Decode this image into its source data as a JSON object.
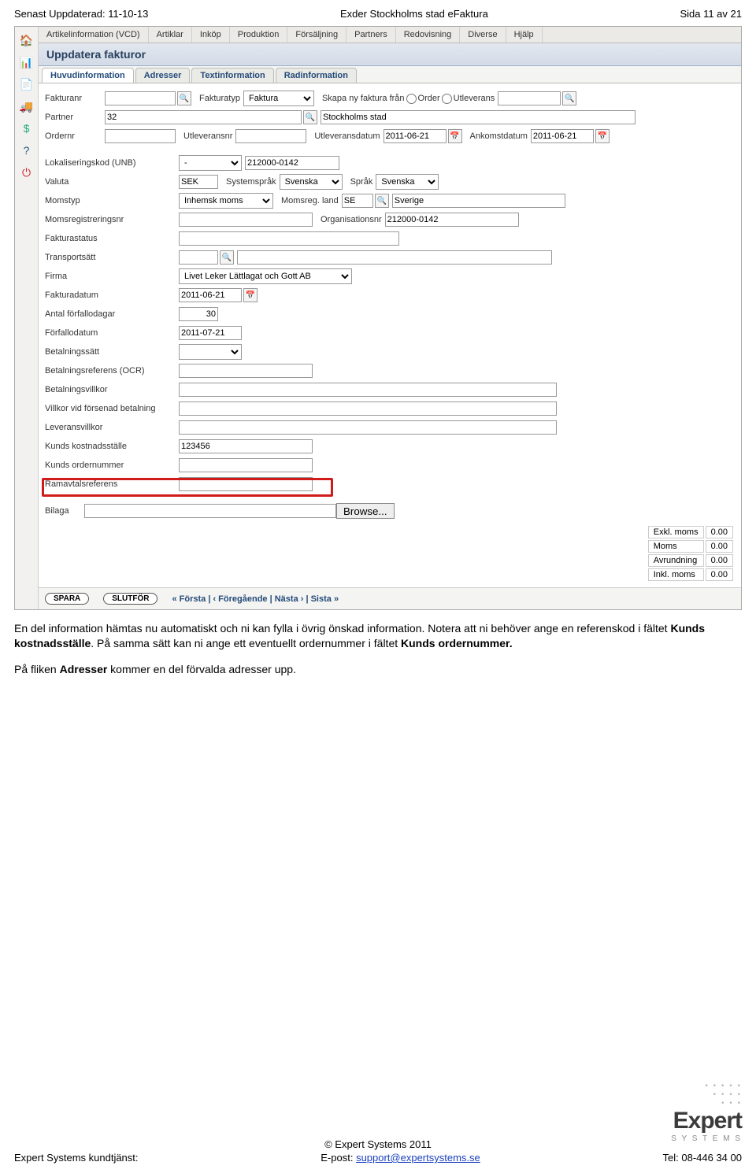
{
  "doc_header": {
    "updated": "Senast Uppdaterad: 11-10-13",
    "title": "Exder Stockholms stad eFaktura",
    "page": "Sida 11 av 21"
  },
  "sidebar_icons": [
    "home-icon",
    "chart-icon",
    "doc-icon",
    "truck-icon",
    "dollar-icon",
    "help-icon",
    "power-icon"
  ],
  "topmenu": [
    "Artikelinformation (VCD)",
    "Artiklar",
    "Inköp",
    "Produktion",
    "Försäljning",
    "Partners",
    "Redovisning",
    "Diverse",
    "Hjälp"
  ],
  "page_title": "Uppdatera fakturor",
  "subtabs": [
    "Huvudinformation",
    "Adresser",
    "Textinformation",
    "Radinformation"
  ],
  "row1": {
    "fakturanr_lbl": "Fakturanr",
    "fakturatyp_lbl": "Fakturatyp",
    "fakturatyp_val": "Faktura",
    "skapa_lbl": "Skapa ny faktura från",
    "opt_order": "Order",
    "opt_utleverans": "Utleverans"
  },
  "row2": {
    "partner_lbl": "Partner",
    "partner_val": "32",
    "partner_name": "Stockholms stad"
  },
  "row3": {
    "ordernr_lbl": "Ordernr",
    "utleveransnr_lbl": "Utleveransnr",
    "utleveransdatum_lbl": "Utleveransdatum",
    "utleveransdatum_val": "2011-06-21",
    "ankomstdatum_lbl": "Ankomstdatum",
    "ankomstdatum_val": "2011-06-21"
  },
  "row4": {
    "lbl": "Lokaliseringskod (UNB)",
    "sel": "-",
    "val": "212000-0142"
  },
  "row5": {
    "lbl": "Valuta",
    "val": "SEK",
    "sysspr_lbl": "Systemspråk",
    "sysspr_val": "Svenska",
    "sprak_lbl": "Språk",
    "sprak_val": "Svenska"
  },
  "row6": {
    "lbl": "Momstyp",
    "val": "Inhemsk moms",
    "momsregland_lbl": "Momsreg. land",
    "momsregland_val": "SE",
    "country": "Sverige"
  },
  "row7": {
    "lbl": "Momsregistreringsnr",
    "orgnr_lbl": "Organisationsnr",
    "orgnr_val": "212000-0142"
  },
  "row8": {
    "lbl": "Fakturastatus"
  },
  "row9": {
    "lbl": "Transportsätt"
  },
  "row10": {
    "lbl": "Firma",
    "val": "Livet Leker Lättlagat och Gott AB"
  },
  "row11": {
    "lbl": "Fakturadatum",
    "val": "2011-06-21"
  },
  "row12": {
    "lbl": "Antal förfallodagar",
    "val": "30"
  },
  "row13": {
    "lbl": "Förfallodatum",
    "val": "2011-07-21"
  },
  "row14": {
    "lbl": "Betalningssätt"
  },
  "row15": {
    "lbl": "Betalningsreferens (OCR)"
  },
  "row16": {
    "lbl": "Betalningsvillkor"
  },
  "row17": {
    "lbl": "Villkor vid försenad betalning"
  },
  "row18": {
    "lbl": "Leveransvillkor"
  },
  "row19": {
    "lbl": "Kunds kostnadsställe",
    "val": "123456"
  },
  "row20": {
    "lbl": "Kunds ordernummer"
  },
  "row21": {
    "lbl": "Ramavtalsreferens"
  },
  "row22": {
    "lbl": "Bilaga",
    "browse": "Browse..."
  },
  "totals": {
    "exkl_lbl": "Exkl. moms",
    "exkl_val": "0.00",
    "moms_lbl": "Moms",
    "moms_val": "0.00",
    "avr_lbl": "Avrundning",
    "avr_val": "0.00",
    "inkl_lbl": "Inkl. moms",
    "inkl_val": "0.00"
  },
  "bottom": {
    "spara": "SPARA",
    "slutfor": "SLUTFÖR",
    "pager": "« Första  |  ‹ Föregående  |  Nästa ›  |  Sista »"
  },
  "body_text": {
    "p1a": "En del information hämtas nu automatiskt och ni kan fylla i övrig önskad information. Notera att ni behöver ange en referenskod i fältet ",
    "p1b": "Kunds kostnadsställe",
    "p1c": ". På samma sätt kan ni ange ett eventuellt ordernummer i fältet ",
    "p1d": "Kunds ordernummer.",
    "p2a": "På fliken ",
    "p2b": "Adresser",
    "p2c": " kommer en del förvalda adresser upp."
  },
  "footer": {
    "copyright": "© Expert Systems 2011",
    "left": "Expert Systems kundtjänst:",
    "mid_lbl": "E-post: ",
    "mid_link": "support@expertsystems.se",
    "right": "Tel: 08-446 34 00"
  },
  "logo": {
    "brand": "Expert",
    "sub": "S Y S T E M S"
  }
}
